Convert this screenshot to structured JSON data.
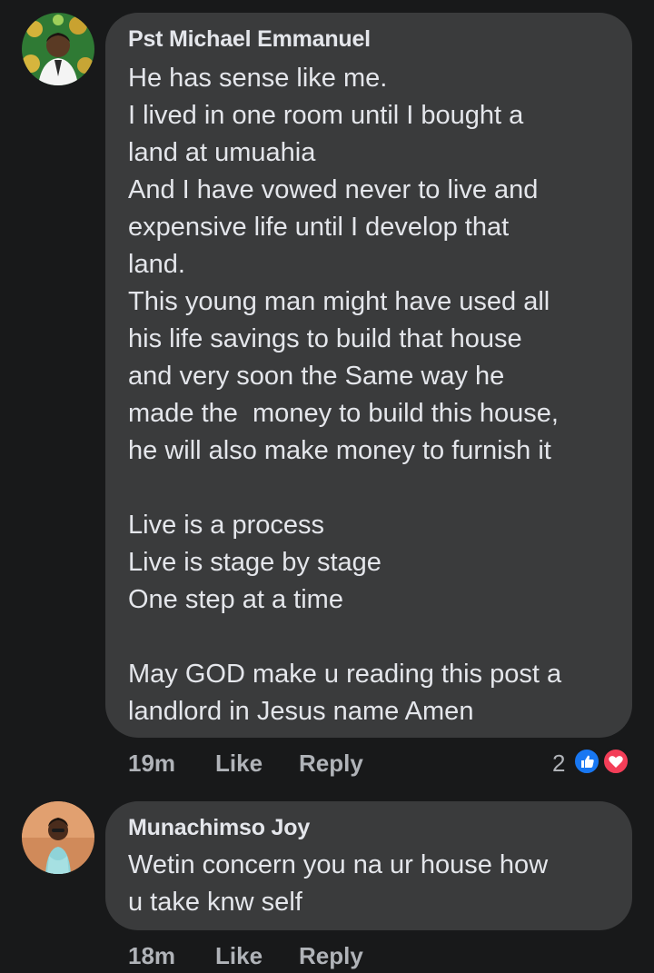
{
  "comments": [
    {
      "author": "Pst Michael Emmanuel",
      "lines": [
        "He has sense like me.",
        "I lived in one room until I bought a",
        "land at umuahia",
        "And I have vowed never to live and",
        "expensive life until I develop that",
        "land.",
        "This young man might have used all",
        "his life savings to build that house",
        "and very soon the Same way he",
        "made the  money to build this house,",
        "he will also make money to furnish it",
        "",
        "Live is a process",
        "Live is stage by stage",
        "One step at a time",
        "",
        "May GOD make u reading this post a",
        "landlord in Jesus name Amen"
      ],
      "time": "19m",
      "like_label": "Like",
      "reply_label": "Reply",
      "reaction_count": "2",
      "reaction_icons": [
        "like-icon",
        "love-icon"
      ]
    },
    {
      "author": "Munachimso Joy",
      "lines": [
        "Wetin concern you na ur house how",
        "u take knw self"
      ],
      "time": "18m",
      "like_label": "Like",
      "reply_label": "Reply"
    }
  ],
  "colors": {
    "background": "#18191a",
    "bubble": "#3a3b3c",
    "text": "#e4e6eb",
    "secondary": "#b0b3b8",
    "like_blue": "#1877f2",
    "love_red": "#f33e58"
  }
}
